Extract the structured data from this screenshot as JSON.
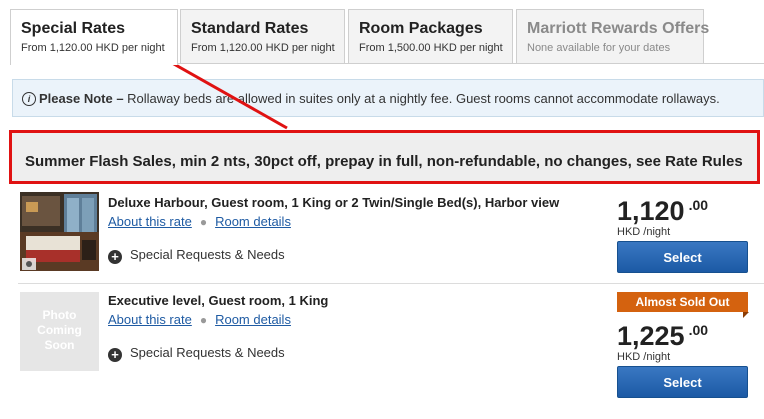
{
  "tabs": [
    {
      "title": "Special Rates",
      "sub": "From 1,120.00 HKD per night"
    },
    {
      "title": "Standard Rates",
      "sub": "From 1,120.00 HKD per night"
    },
    {
      "title": "Room Packages",
      "sub": "From 1,500.00 HKD per night"
    },
    {
      "title": "Marriott Rewards Offers",
      "sub": "None available for your dates"
    }
  ],
  "note": {
    "icon": "info-icon",
    "label": "Please Note –",
    "text": " Rollaway beds are allowed in suites only at a nightly fee. Guest rooms cannot accommodate rollaways."
  },
  "promo": {
    "text": "Summer Flash Sales, min 2 nts, 30pct off, prepay in full, non-refundable, no changes, see Rate Rules"
  },
  "rooms": [
    {
      "name": "Deluxe Harbour, Guest room, 1 King or 2 Twin/Single Bed(s), Harbor view",
      "about": "About this rate",
      "details": "Room details",
      "special": "Special Requests & Needs",
      "price": "1,120",
      "cents": ".00",
      "unit": "HKD /night",
      "select": "Select"
    },
    {
      "name": "Executive level, Guest room, 1 King",
      "about": "About this rate",
      "details": "Room details",
      "special": "Special Requests & Needs",
      "photo_placeholder": [
        "Photo",
        "Coming",
        "Soon"
      ],
      "badge": "Almost Sold Out",
      "price": "1,225",
      "cents": ".00",
      "unit": "HKD /night",
      "select": "Select"
    }
  ],
  "colors": {
    "promo_border": "#e01212",
    "annotation_arrow": "#e01212",
    "link": "#1f5ba3",
    "button": "#1c5aa5",
    "badge": "#d4620f"
  }
}
